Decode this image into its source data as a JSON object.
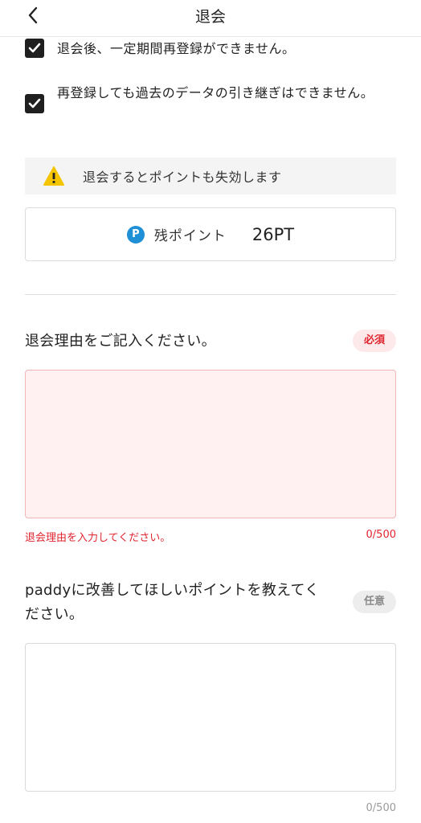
{
  "header": {
    "title": "退会",
    "back_icon": "chevron-left-icon"
  },
  "checks": [
    {
      "label": "退会後、一定期間再登録ができません。",
      "checked": true
    },
    {
      "label": "再登録しても過去のデータの引き継ぎはできません。",
      "checked": true
    }
  ],
  "warning": {
    "text": "退会するとポイントも失効します",
    "icon": "warning-icon",
    "icon_color": "#f5c400"
  },
  "points": {
    "icon_letter": "P",
    "label": "残ポイント",
    "value": "26PT",
    "icon_color": "#1f8fd6"
  },
  "reason": {
    "label": "退会理由をご記入ください。",
    "badge": "必須",
    "error": "退会理由を入力してください。",
    "counter": "0/500",
    "value": ""
  },
  "improvement": {
    "label": "paddyに改善してほしいポイントを教えてください。",
    "badge": "任意",
    "counter": "0/500",
    "value": ""
  },
  "colors": {
    "error": "#e0252f",
    "error_bg": "#fff1f1"
  }
}
